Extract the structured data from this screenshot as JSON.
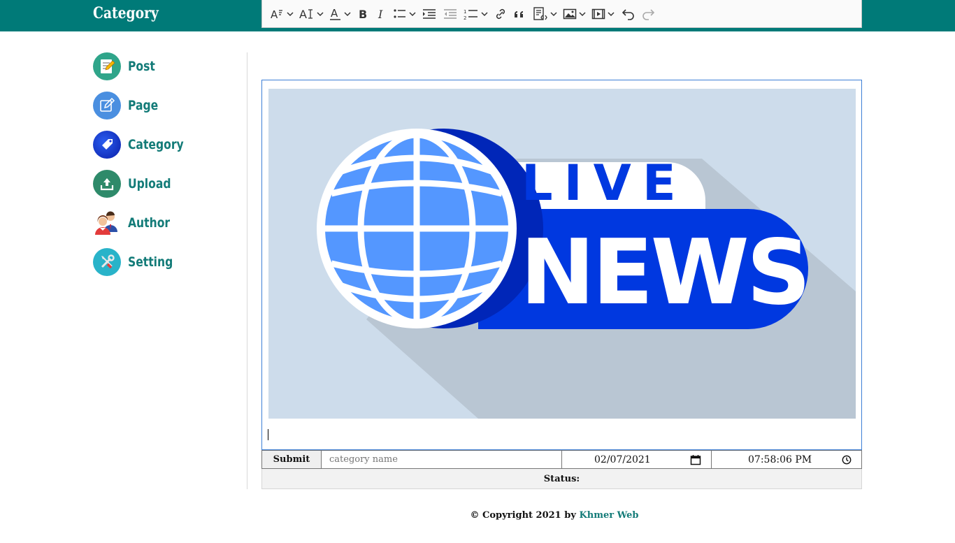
{
  "header": {
    "title": "Category",
    "bg_color": "#007a78"
  },
  "toolbar": {
    "buttons": [
      {
        "name": "font-size",
        "icon": "font-size-icon",
        "dropdown": true
      },
      {
        "name": "font-family",
        "icon": "font-family-icon",
        "dropdown": true
      },
      {
        "name": "font-color",
        "icon": "font-color-icon",
        "dropdown": true
      },
      {
        "name": "bold",
        "icon": "bold-icon",
        "dropdown": false
      },
      {
        "name": "italic",
        "icon": "italic-icon",
        "dropdown": false
      },
      {
        "name": "bulleted-list",
        "icon": "bulleted-list-icon",
        "dropdown": true
      },
      {
        "name": "indent",
        "icon": "indent-icon",
        "dropdown": false
      },
      {
        "name": "outdent",
        "icon": "outdent-icon",
        "dropdown": false
      },
      {
        "name": "numbered-list",
        "icon": "numbered-list-icon",
        "dropdown": true
      },
      {
        "name": "link",
        "icon": "link-icon",
        "dropdown": false
      },
      {
        "name": "block-quote",
        "icon": "quote-icon",
        "dropdown": false
      },
      {
        "name": "source-edit",
        "icon": "source-edit-icon",
        "dropdown": true
      },
      {
        "name": "insert-image",
        "icon": "image-icon",
        "dropdown": true
      },
      {
        "name": "insert-media",
        "icon": "media-icon",
        "dropdown": true
      },
      {
        "name": "undo",
        "icon": "undo-icon",
        "dropdown": false
      },
      {
        "name": "redo",
        "icon": "redo-icon",
        "dropdown": false,
        "disabled": true
      }
    ]
  },
  "sidebar": {
    "items": [
      {
        "label": "Post",
        "icon": "post-icon"
      },
      {
        "label": "Page",
        "icon": "page-icon"
      },
      {
        "label": "Category",
        "icon": "category-tag-icon"
      },
      {
        "label": "Upload",
        "icon": "upload-icon"
      },
      {
        "label": "Author",
        "icon": "author-icon"
      },
      {
        "label": "Setting",
        "icon": "setting-tools-icon"
      }
    ],
    "label_color": "#137b78"
  },
  "editor": {
    "image": {
      "line1": "LIVE",
      "line2": "NEWS",
      "bg_color": "#cddceb",
      "accent_color": "#0038e0",
      "globe_color": "#5497ff"
    }
  },
  "form": {
    "submit_label": "Submit",
    "name_placeholder": "category name",
    "date_value": "02/07/2021",
    "time_value": "07:58:06 PM",
    "status_label": "Status:"
  },
  "footer": {
    "prefix": "© Copyright 2021 by",
    "link_text": "Khmer Web"
  }
}
